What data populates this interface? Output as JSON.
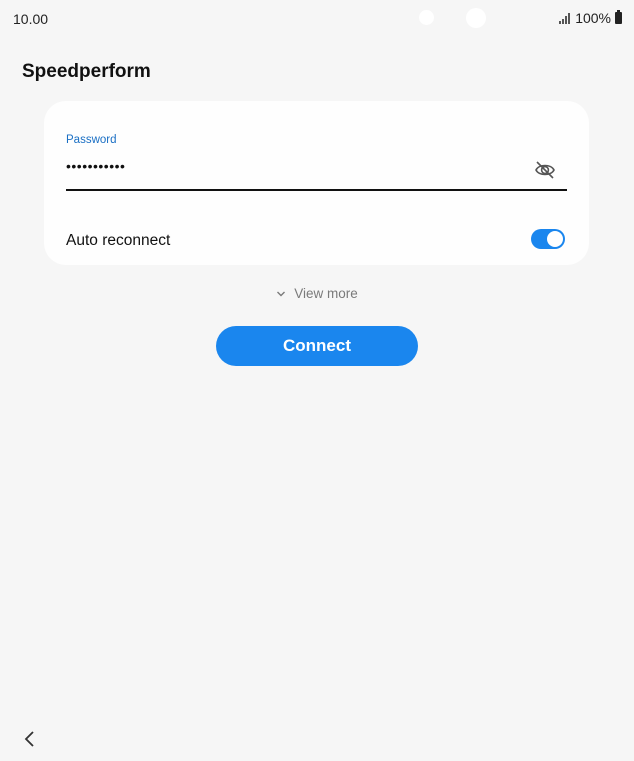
{
  "status_bar": {
    "time": "10.00",
    "battery": "100%"
  },
  "page": {
    "title": "Speedperform"
  },
  "password_field": {
    "label": "Password",
    "value": "•••••••••••",
    "visibility_icon": "eye-off-icon"
  },
  "auto_reconnect": {
    "label": "Auto reconnect",
    "enabled": true
  },
  "view_more": {
    "label": "View more",
    "icon": "chevron-down-icon"
  },
  "connect_button": {
    "label": "Connect"
  },
  "nav": {
    "back_icon": "chevron-left-icon"
  },
  "colors": {
    "accent": "#1a86ee",
    "label_blue": "#1a6fc4",
    "background": "#f6f6f6",
    "card": "#fefefe"
  }
}
